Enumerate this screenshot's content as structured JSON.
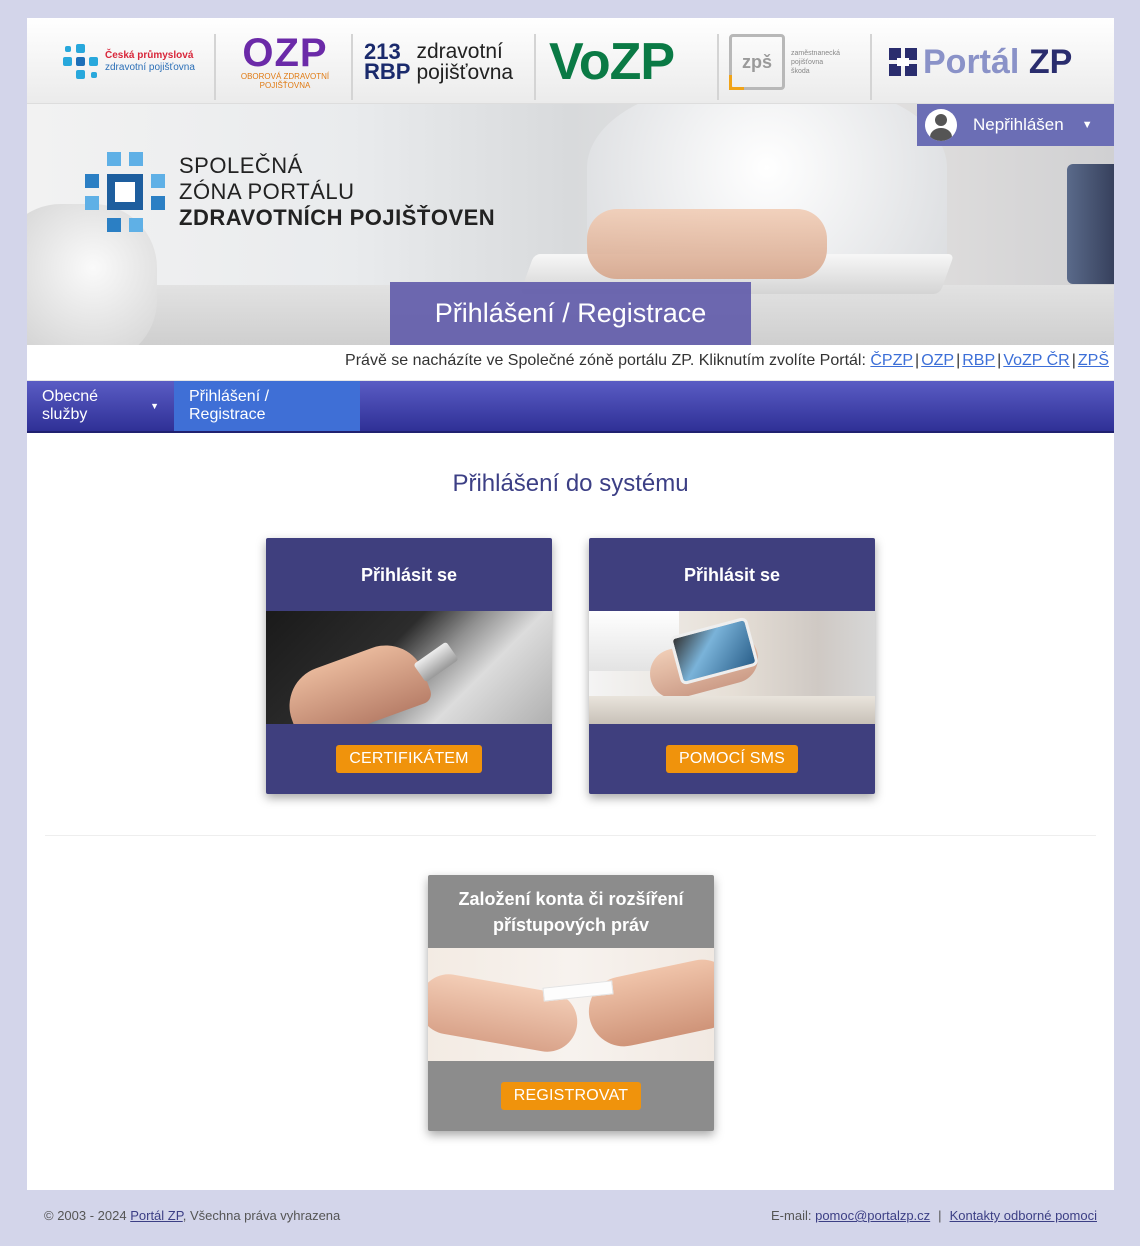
{
  "logos": {
    "cpzp": {
      "line1": "Česká průmyslová",
      "line2": "zdravotní pojišťovna"
    },
    "ozp": {
      "name": "OZP",
      "line1": "OBOROVÁ ZDRAVOTNÍ",
      "line2": "POJIŠŤOVNA"
    },
    "rbp": {
      "num1": "213",
      "num2": "RBP",
      "line1": "zdravotní",
      "line2": "pojišťovna"
    },
    "vozp": {
      "name": "VoZP"
    },
    "zps": {
      "mark": "zpš",
      "line1": "zaměstnanecká",
      "line2": "pojišťovna",
      "line3": "škoda"
    },
    "portal": {
      "light": "Portál",
      "bold": "ZP"
    }
  },
  "hero": {
    "title_line1": "SPOLEČNÁ",
    "title_line2": "ZÓNA PORTÁLU",
    "title_line3": "ZDRAVOTNÍCH POJIŠŤOVEN",
    "banner": "Přihlášení / Registrace"
  },
  "user_menu": {
    "label": "Nepřihlášen",
    "icon": "user-avatar-icon"
  },
  "switch": {
    "text": "Právě se nacházíte ve Společné zóně portálu ZP. Kliknutím zvolíte Portál:",
    "links": [
      "ČPZP",
      "OZP",
      "RBP",
      "VoZP ČR",
      "ZPŠ"
    ]
  },
  "nav": {
    "general": "Obecné služby",
    "active": "Přihlášení / Registrace"
  },
  "main": {
    "title": "Přihlášení do systému",
    "cards": [
      {
        "title": "Přihlásit se",
        "button": "CERTIFIKÁTEM"
      },
      {
        "title": "Přihlásit se",
        "button": "POMOCÍ SMS"
      },
      {
        "title": "Založení konta či rozšíření přístupových práv",
        "button": "REGISTROVAT"
      }
    ]
  },
  "footer": {
    "copyright_prefix": "© 2003 - 2024",
    "portal_link": "Portál ZP",
    "copyright_suffix": ", Všechna práva vyhrazena",
    "email_label": "E-mail:",
    "email": "pomoc@portalzp.cz",
    "contacts": "Kontakty odborné pomoci"
  },
  "colors": {
    "page_bg": "#d3d5ea",
    "nav": "#3a3ba8",
    "nav_active": "#3f6fd6",
    "card": "#3f3f7e",
    "card_grey": "#8c8c8c",
    "button": "#f0930c",
    "title": "#3c3f85"
  }
}
